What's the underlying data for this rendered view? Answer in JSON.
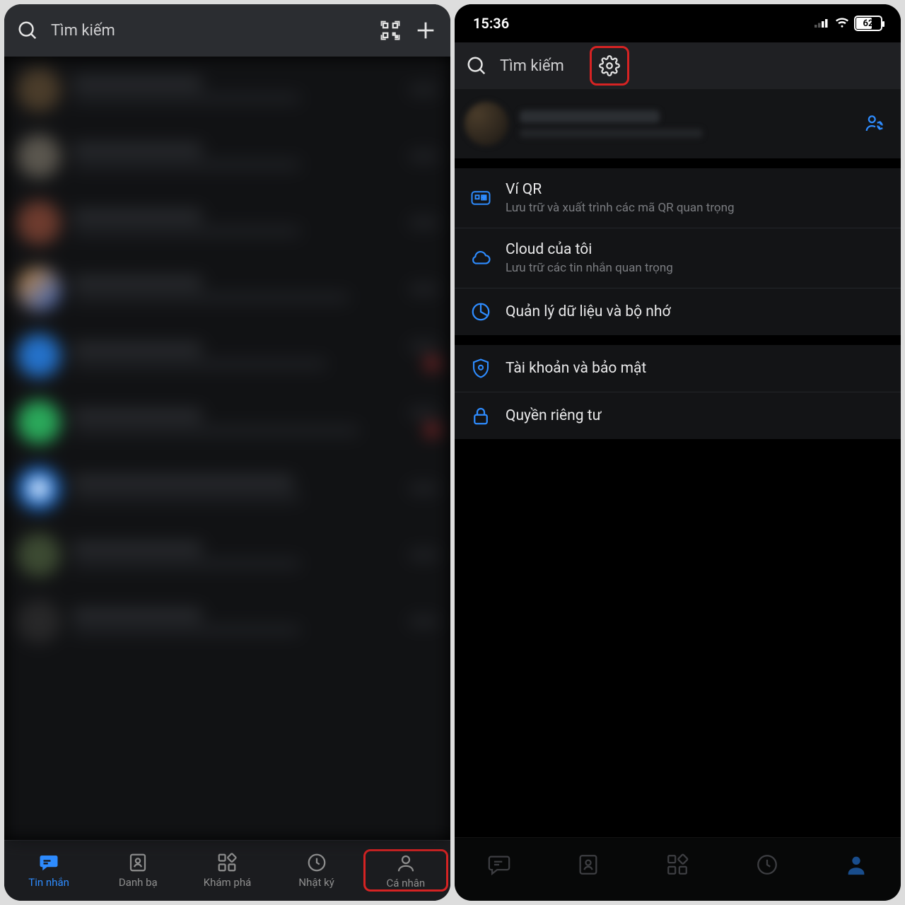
{
  "left": {
    "search_placeholder": "Tìm kiếm",
    "tabs": {
      "messages": "Tin nhắn",
      "contacts": "Danh bạ",
      "discover": "Khám phá",
      "diary": "Nhật ký",
      "personal": "Cá nhân"
    }
  },
  "right": {
    "status": {
      "time": "15:36",
      "battery": "62"
    },
    "search_placeholder": "Tìm kiếm",
    "menu": {
      "qr_wallet": {
        "title": "Ví QR",
        "sub": "Lưu trữ và xuất trình các mã QR quan trọng"
      },
      "my_cloud": {
        "title": "Cloud của tôi",
        "sub": "Lưu trữ các tin nhắn quan trọng"
      },
      "data_storage": {
        "title": "Quản lý dữ liệu và bộ nhớ"
      },
      "account_security": {
        "title": "Tài khoản và bảo mật"
      },
      "privacy": {
        "title": "Quyền riêng tư"
      }
    }
  }
}
